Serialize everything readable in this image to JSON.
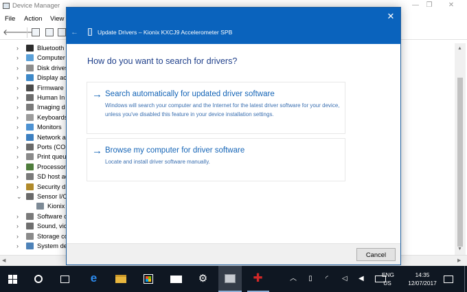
{
  "device_manager": {
    "title": "Device Manager",
    "menu": [
      "File",
      "Action",
      "View"
    ],
    "tree": [
      {
        "label": "Bluetooth",
        "chevron": "›",
        "icon_color": "#2c2c2c",
        "child": false
      },
      {
        "label": "Computer",
        "chevron": "›",
        "icon_color": "#5aa0d8",
        "child": false
      },
      {
        "label": "Disk drives",
        "chevron": "›",
        "icon_color": "#8d8d8d",
        "child": false
      },
      {
        "label": "Display ac",
        "chevron": "›",
        "icon_color": "#3d88c8",
        "child": false
      },
      {
        "label": "Firmware",
        "chevron": "›",
        "icon_color": "#4a4a4a",
        "child": false
      },
      {
        "label": "Human In",
        "chevron": "›",
        "icon_color": "#6c6c6c",
        "child": false
      },
      {
        "label": "Imaging d",
        "chevron": "›",
        "icon_color": "#7a7a7a",
        "child": false
      },
      {
        "label": "Keyboards",
        "chevron": "›",
        "icon_color": "#9c9c9c",
        "child": false
      },
      {
        "label": "Monitors",
        "chevron": "›",
        "icon_color": "#4d92d2",
        "child": false
      },
      {
        "label": "Network a",
        "chevron": "›",
        "icon_color": "#3c7fc0",
        "child": false
      },
      {
        "label": "Ports (CON",
        "chevron": "›",
        "icon_color": "#6a6a6a",
        "child": false
      },
      {
        "label": "Print queu",
        "chevron": "›",
        "icon_color": "#8a8a8a",
        "child": false
      },
      {
        "label": "Processors",
        "chevron": "›",
        "icon_color": "#4f7d3c",
        "child": false
      },
      {
        "label": "SD host ad",
        "chevron": "›",
        "icon_color": "#7a7a7a",
        "child": false
      },
      {
        "label": "Security d",
        "chevron": "›",
        "icon_color": "#b08a2a",
        "child": false
      },
      {
        "label": "Sensor I/C",
        "chevron": "⌄",
        "icon_color": "#6a6a6a",
        "child": false
      },
      {
        "label": "Kionix",
        "chevron": "",
        "icon_color": "#7d8a96",
        "child": true
      },
      {
        "label": "Software d",
        "chevron": "›",
        "icon_color": "#7a7a7a",
        "child": false
      },
      {
        "label": "Sound, vic",
        "chevron": "›",
        "icon_color": "#6f6f6f",
        "child": false
      },
      {
        "label": "Storage co",
        "chevron": "›",
        "icon_color": "#8a8a8a",
        "child": false
      },
      {
        "label": "System de",
        "chevron": "›",
        "icon_color": "#4d82b8",
        "child": false
      }
    ],
    "window_controls": {
      "minimize": "—",
      "maximize": "❐",
      "close": "✕"
    }
  },
  "dialog": {
    "title": "Update Drivers – Kionix KXCJ9 Accelerometer SPB",
    "close": "✕",
    "back": "←",
    "heading": "How do you want to search for drivers?",
    "options": [
      {
        "arrow": "→",
        "title": "Search automatically for updated driver software",
        "description": "Windows will search your computer and the Internet for the latest driver software for your device, unless you've disabled this feature in your device installation settings."
      },
      {
        "arrow": "→",
        "title": "Browse my computer for driver software",
        "description": "Locate and install driver software manually."
      }
    ],
    "cancel_label": "Cancel"
  },
  "taskbar": {
    "icons": [
      "windows-start-icon",
      "cortana-icon",
      "task-view-icon",
      "edge-icon",
      "file-explorer-icon",
      "store-icon",
      "mail-icon",
      "settings-icon",
      "device-manager-icon",
      "red-app-icon"
    ],
    "tray": {
      "chevron": "︿",
      "wifi": "◜",
      "tablet": "◁",
      "volume": "◀",
      "lang_top": "ENG",
      "lang_bottom": "US",
      "time": "14:35",
      "date": "12/07/2017"
    }
  },
  "colors": {
    "dialog_titlebar": "#0a63bd",
    "link_blue": "#1464b6",
    "heading_blue": "#1e3f8a",
    "taskbar": "#0f1722"
  }
}
